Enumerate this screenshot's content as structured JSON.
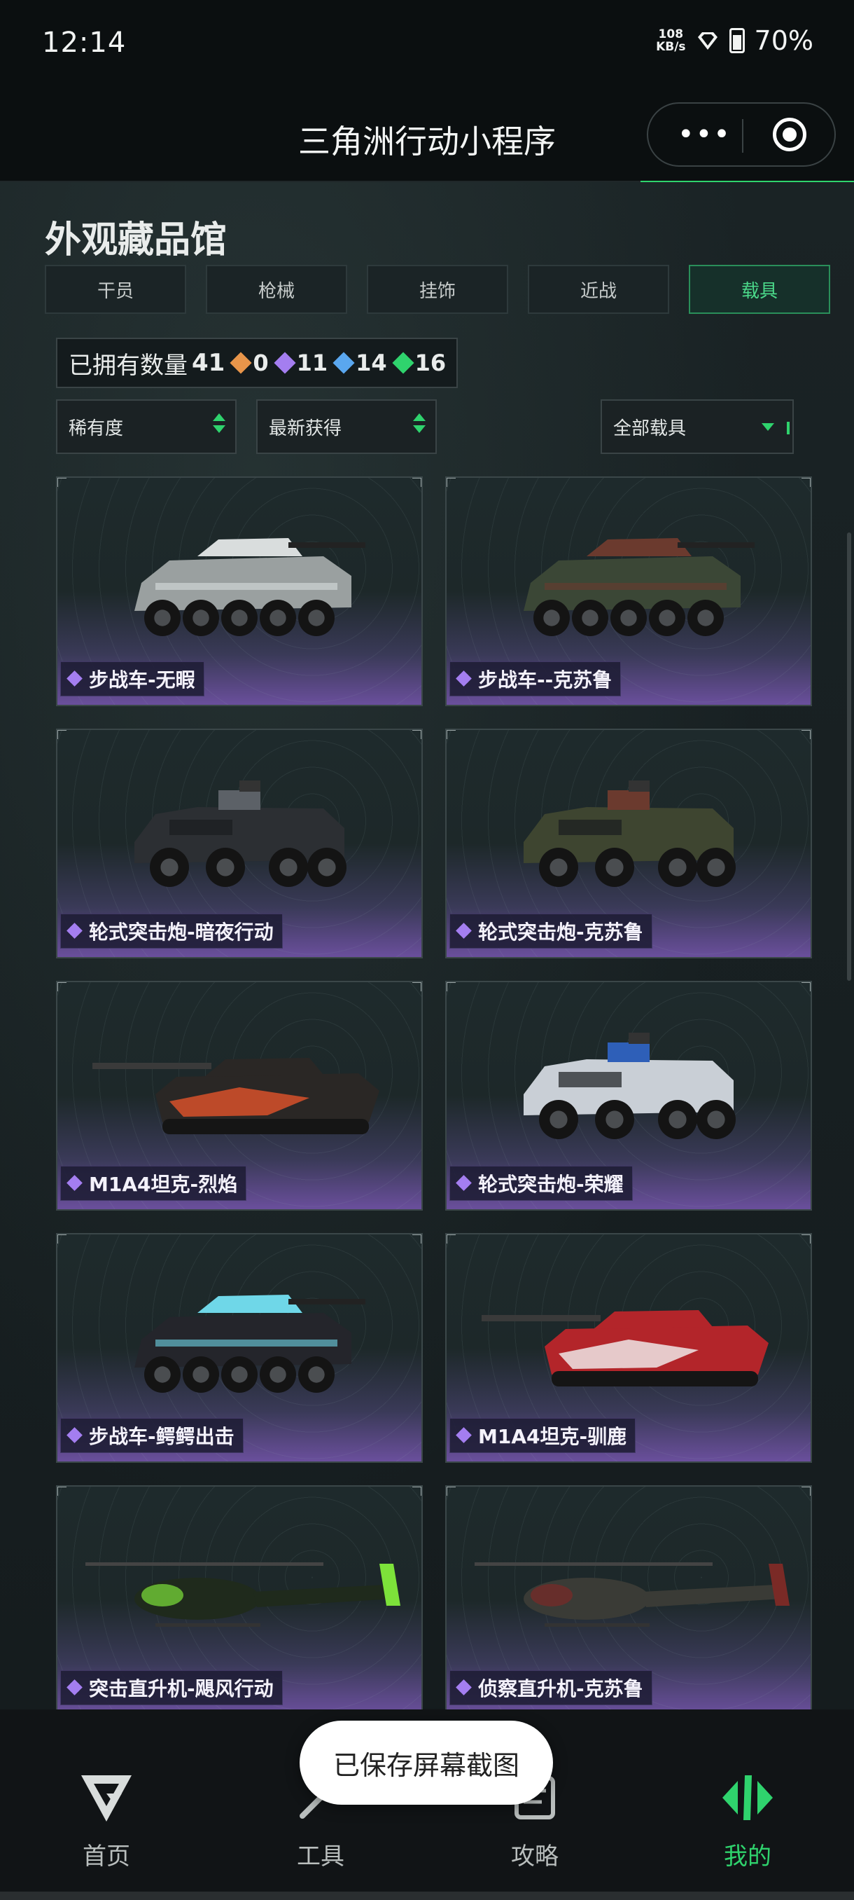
{
  "status_bar": {
    "time": "12:14",
    "net_speed_value": "108",
    "net_speed_unit": "KB/s",
    "battery": "70%"
  },
  "title_bar": {
    "title": "三角洲行动小程序"
  },
  "page": {
    "title": "外观藏品馆"
  },
  "tabs": [
    {
      "label": "干员",
      "active": false
    },
    {
      "label": "枪械",
      "active": false
    },
    {
      "label": "挂饰",
      "active": false
    },
    {
      "label": "近战",
      "active": false
    },
    {
      "label": "载具",
      "active": true
    }
  ],
  "owned": {
    "label": "已拥有数量",
    "total": "41",
    "rarity": [
      {
        "count": "0",
        "color": "#e8954a"
      },
      {
        "count": "11",
        "color": "#a47ef0"
      },
      {
        "count": "14",
        "color": "#5aa7ef"
      },
      {
        "count": "16",
        "color": "#2fd36d"
      }
    ]
  },
  "filters": {
    "rarity": "稀有度",
    "sort": "最新获得",
    "type": "全部载具"
  },
  "vehicles": [
    {
      "name": "步战车-无暇",
      "kind": "ifv",
      "body": "#9aa0a0",
      "accent": "#d9dddd"
    },
    {
      "name": "步战车--克苏鲁",
      "kind": "ifv",
      "body": "#3b4736",
      "accent": "#6b3a2e"
    },
    {
      "name": "轮式突击炮-暗夜行动",
      "kind": "apc",
      "body": "#2c2f33",
      "accent": "#5c6167"
    },
    {
      "name": "轮式突击炮-克苏鲁",
      "kind": "apc",
      "body": "#3e4530",
      "accent": "#6b3a2e"
    },
    {
      "name": "M1A4坦克-烈焰",
      "kind": "tank",
      "body": "#2a2725",
      "accent": "#e2542a"
    },
    {
      "name": "轮式突击炮-荣耀",
      "kind": "apc",
      "body": "#c9cfd6",
      "accent": "#2e5fb8"
    },
    {
      "name": "步战车-鳄鳄出击",
      "kind": "ifv",
      "body": "#24252b",
      "accent": "#6fd7e8"
    },
    {
      "name": "M1A4坦克-驯鹿",
      "kind": "tank",
      "body": "#b3252a",
      "accent": "#f2f2f2"
    },
    {
      "name": "突击直升机-飓风行动",
      "kind": "heli",
      "body": "#1f2a1c",
      "accent": "#7de23a"
    },
    {
      "name": "侦察直升机-克苏鲁",
      "kind": "heli",
      "body": "#3a3b36",
      "accent": "#7a2a26"
    }
  ],
  "toast": "已保存屏幕截图",
  "bottom_nav": [
    {
      "label": "首页",
      "icon": "delta-logo-icon",
      "active": false
    },
    {
      "label": "工具",
      "icon": "tools-icon",
      "active": false
    },
    {
      "label": "攻略",
      "icon": "guide-icon",
      "active": false
    },
    {
      "label": "我的",
      "icon": "profile-logo-icon",
      "active": true
    }
  ]
}
